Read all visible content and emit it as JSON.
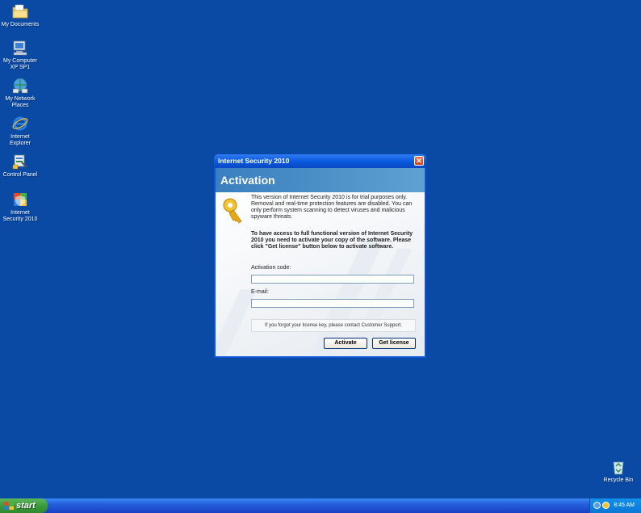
{
  "desktop": {
    "icons": [
      {
        "label": "My Documents",
        "icon": "folder-icon"
      },
      {
        "label": "My Computer XP SP1",
        "icon": "computer-icon"
      },
      {
        "label": "My Network Places",
        "icon": "network-icon"
      },
      {
        "label": "Internet Explorer",
        "icon": "ie-icon"
      },
      {
        "label": "Control Panel",
        "icon": "control-panel-icon"
      },
      {
        "label": "Internet Security 2010",
        "icon": "shield-icon"
      }
    ],
    "recycle_bin": {
      "label": "Recycle Bin",
      "icon": "recycle-bin-icon"
    }
  },
  "dialog": {
    "title": "Internet Security 2010",
    "close_glyph": "✕",
    "banner": "Activation",
    "paragraph1": "This version of Internet Security 2010 is for trial purposes only. Removal and real-time protection features are disabled. You can only perform system scanning to detect viruses and malicious spyware threats.",
    "paragraph2": "To have access to full functional version of Internet Security 2010 you need to activate your copy of the software. Please click \"Get license\" button below to activate software.",
    "activation_label": "Activation code:",
    "activation_value": "",
    "email_label": "E-mail:",
    "email_value": "",
    "notice": "If you forgot your license key, please contact Customer Support.",
    "activate_button": "Activate",
    "get_license_button": "Get license"
  },
  "taskbar": {
    "start_label": "start",
    "clock": "8:45 AM"
  },
  "colors": {
    "desktop": "#0a4aa4",
    "titlebar": "#0a58dd",
    "banner": "#4f93c9",
    "start": "#3c9a3c"
  }
}
